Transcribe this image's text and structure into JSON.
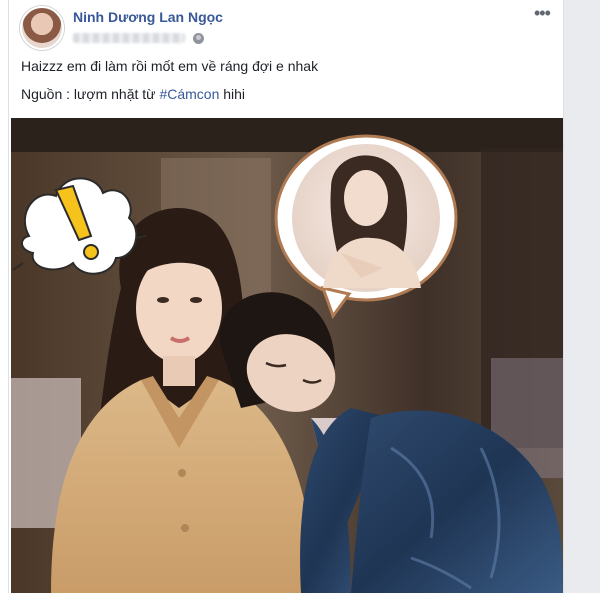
{
  "post": {
    "author": "Ninh Dương Lan Ngọc",
    "line1": "Haizzz em đi làm rồi mốt em về ráng đợi e nhak",
    "line2_prefix": "Nguồn : lượm nhặt từ ",
    "hashtag": "#Cámcon",
    "line2_suffix": " hihi"
  },
  "icons": {
    "more": "more-options-icon",
    "privacy": "globe-icon",
    "alert": "exclamation-icon"
  },
  "colors": {
    "link": "#385898",
    "text": "#1d2129",
    "page_bg": "#e9ebee"
  }
}
